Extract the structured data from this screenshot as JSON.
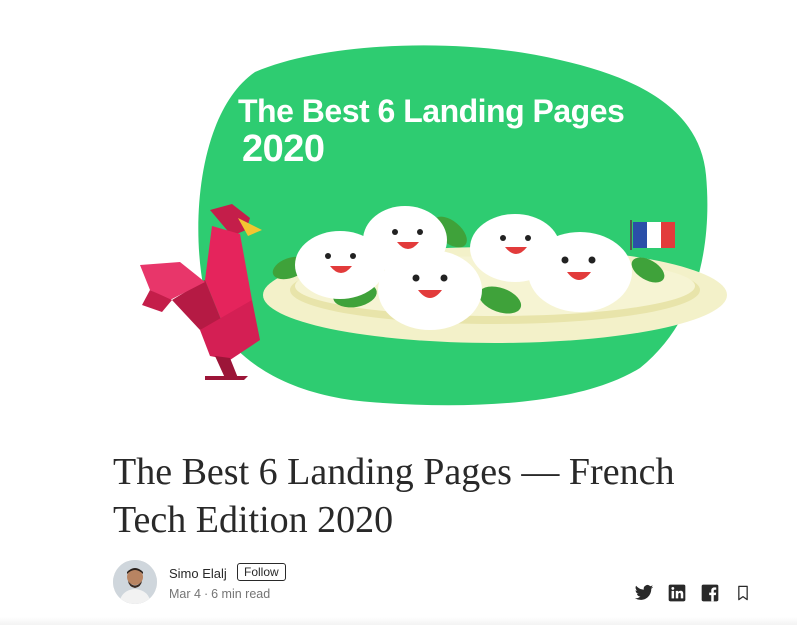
{
  "hero": {
    "title_line1": "The Best 6 Landing Pages",
    "title_line2": "2020",
    "colors": {
      "blob": "#2ecc71",
      "plate": "#f3f1c9",
      "rooster": "#e5245c"
    }
  },
  "article": {
    "title": "The Best 6 Landing Pages — French Tech Edition 2020"
  },
  "author": {
    "name": "Simo Elalj",
    "follow_label": "Follow",
    "date": "Mar 4",
    "separator": "·",
    "read_time": "6 min read"
  },
  "share": {
    "icons": [
      "twitter-icon",
      "linkedin-icon",
      "facebook-icon",
      "bookmark-icon"
    ]
  }
}
